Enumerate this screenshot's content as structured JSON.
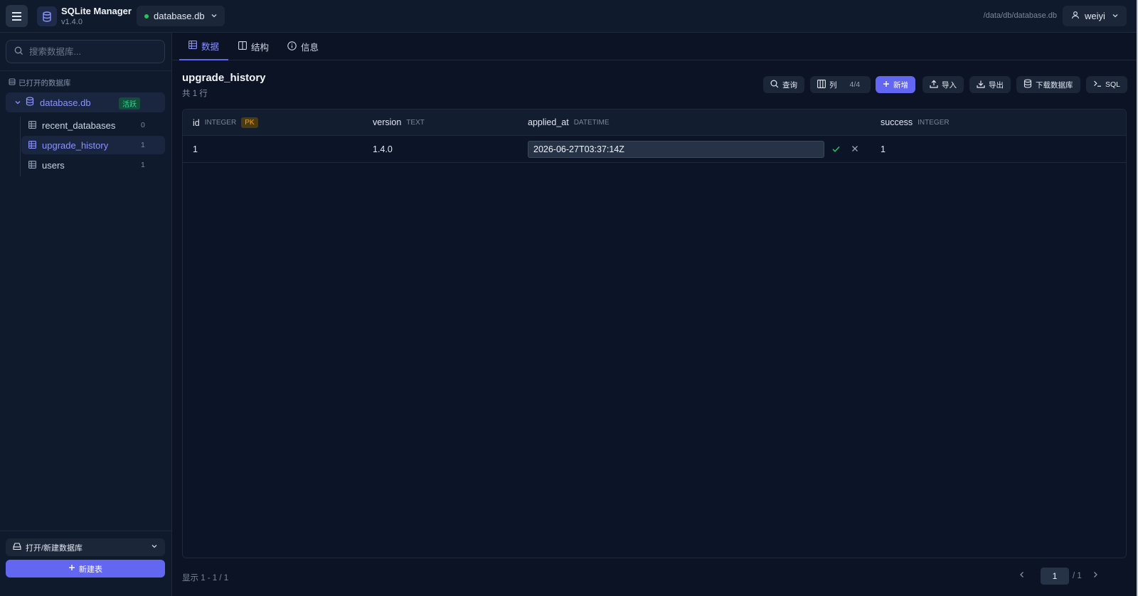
{
  "header": {
    "app_title": "SQLite Manager",
    "app_version": "v1.4.0",
    "db_select": "database.db",
    "db_path": "/data/db/database.db",
    "user": "weiyi",
    "status_color": "#22c55e"
  },
  "sidebar": {
    "search_placeholder": "搜索数据库...",
    "section_label": "已打开的数据库",
    "database": {
      "name": "database.db",
      "badge": "活跃"
    },
    "tables": [
      {
        "name": "recent_databases",
        "count": "0"
      },
      {
        "name": "upgrade_history",
        "count": "1"
      },
      {
        "name": "users",
        "count": "1"
      }
    ],
    "open_db_label": "打开/新建数据库",
    "new_table_label": "新建表"
  },
  "tabs": [
    {
      "label": "数据",
      "icon": "table-icon",
      "active": true
    },
    {
      "label": "结构",
      "icon": "columns-icon",
      "active": false
    },
    {
      "label": "信息",
      "icon": "info-icon",
      "active": false
    }
  ],
  "main": {
    "table_title": "upgrade_history",
    "row_count": "共 1 行"
  },
  "toolbar": {
    "query": "查询",
    "columns": "列",
    "columns_count": "4/4",
    "add": "新增",
    "import": "导入",
    "export": "导出",
    "download": "下载数据库",
    "sql": "SQL"
  },
  "grid": {
    "columns": [
      {
        "name": "id",
        "type": "INTEGER",
        "pk": "PK"
      },
      {
        "name": "version",
        "type": "TEXT"
      },
      {
        "name": "applied_at",
        "type": "DATETIME"
      },
      {
        "name": "success",
        "type": "INTEGER"
      }
    ],
    "rows": [
      {
        "id": "1",
        "version": "1.4.0",
        "applied_at": "2026-06-27T03:37:14Z",
        "success": "1"
      }
    ]
  },
  "footer": {
    "display": "显示 1 - 1 / 1",
    "page": "1",
    "total": "/ 1"
  },
  "colors": {
    "accent": "#6366f1",
    "accent_text": "#8b93ff",
    "active_badge": "#34d399",
    "pk_badge": "#f59e0b",
    "background": "#0b1324"
  }
}
